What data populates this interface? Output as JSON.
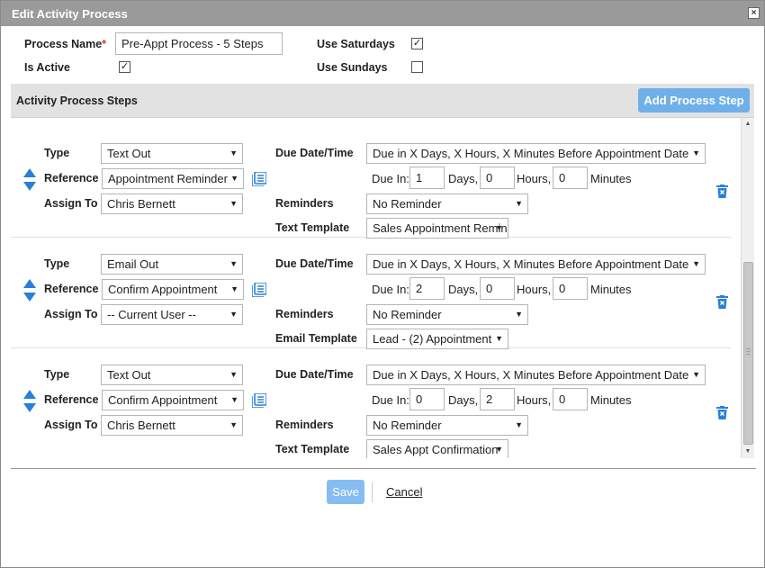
{
  "dialog": {
    "title": "Edit Activity Process",
    "close_label": "×"
  },
  "form": {
    "process_name_label": "Process Name",
    "required_marker": "*",
    "process_name_value": "Pre-Appt Process - 5 Steps",
    "is_active_label": "Is Active",
    "is_active_checked": true,
    "use_saturdays_label": "Use Saturdays",
    "use_saturdays_checked": true,
    "use_sundays_label": "Use Sundays",
    "use_sundays_checked": false
  },
  "steps_section": {
    "title": "Activity Process Steps",
    "add_button": "Add Process Step"
  },
  "labels": {
    "type": "Type",
    "reference": "Reference",
    "assign_to": "Assign To",
    "due_date_time": "Due Date/Time",
    "due_in": "Due In:",
    "days": "Days,",
    "hours": "Hours,",
    "minutes": "Minutes",
    "reminders": "Reminders"
  },
  "steps": [
    {
      "type": "Text Out",
      "reference": "Appointment Reminder",
      "assign_to": "Chris Bernett",
      "due_date_time": "Due in X Days, X Hours, X Minutes Before Appointment Date",
      "due_days": "1",
      "due_hours": "0",
      "due_minutes": "0",
      "reminders": "No Reminder",
      "template_label": "Text Template",
      "template_value": "Sales Appointment Reminder"
    },
    {
      "type": "Email Out",
      "reference": "Confirm Appointment",
      "assign_to": "-- Current User --",
      "due_date_time": "Due in X Days, X Hours, X Minutes Before Appointment Date",
      "due_days": "2",
      "due_hours": "0",
      "due_minutes": "0",
      "reminders": "No Reminder",
      "template_label": "Email Template",
      "template_value": "Lead - (2) Appointment"
    },
    {
      "type": "Text Out",
      "reference": "Confirm Appointment",
      "assign_to": "Chris Bernett",
      "due_date_time": "Due in X Days, X Hours, X Minutes Before Appointment Date",
      "due_days": "0",
      "due_hours": "2",
      "due_minutes": "0",
      "reminders": "No Reminder",
      "template_label": "Text Template",
      "template_value": "Sales Appt Confirmation"
    }
  ],
  "footer": {
    "save": "Save",
    "cancel": "Cancel"
  },
  "colors": {
    "titlebar": "#9a9a9a",
    "accent": "#6fb0ea",
    "icon_blue": "#2a7fd4"
  },
  "icons": {
    "reorder": "up-down-arrows-icon",
    "reference": "list-icon",
    "delete": "trash-icon"
  }
}
